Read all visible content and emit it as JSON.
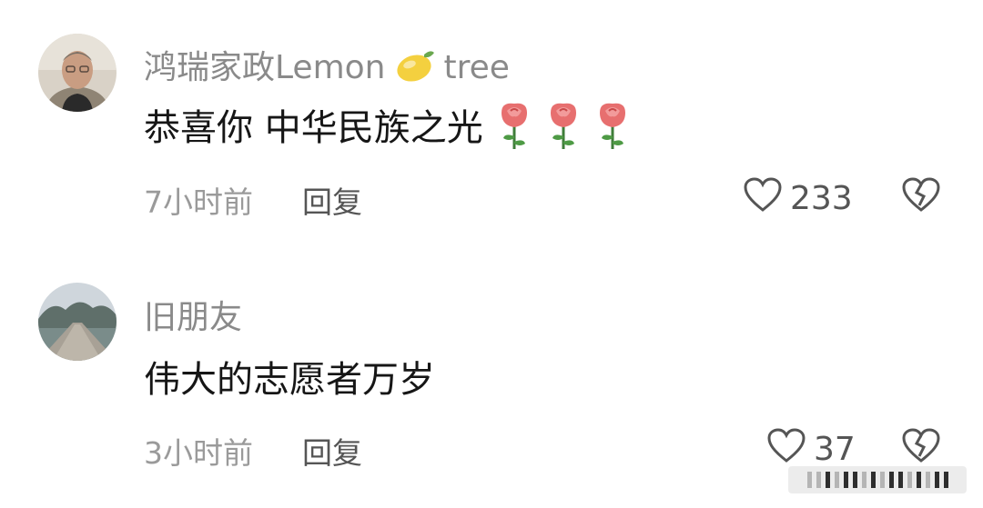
{
  "comments": [
    {
      "username": "鸿瑞家政Lemon",
      "username_suffix": "tree",
      "username_emoji": "lemon-emoji",
      "text": "恭喜你 中华民族之光",
      "text_emojis": [
        "rose-emoji",
        "rose-emoji",
        "rose-emoji"
      ],
      "time": "7小时前",
      "reply_label": "回复",
      "likes": "233"
    },
    {
      "username": "旧朋友",
      "text": "伟大的志愿者万岁",
      "time": "3小时前",
      "reply_label": "回复",
      "likes": "37"
    }
  ],
  "colors": {
    "username": "#8a8a8a",
    "comment_text": "#161616",
    "meta": "#9a9a9a",
    "icon": "#555555"
  }
}
